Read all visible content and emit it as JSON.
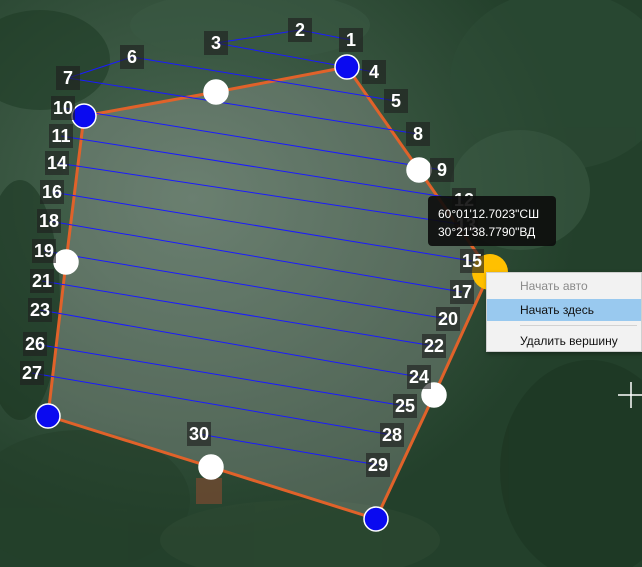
{
  "map": {
    "boundary_color": "#e0622a",
    "track_color": "#1a1aff",
    "vertex_active_color": "#0a0af0",
    "vertex_inactive_color": "#ffffff",
    "vertex_selected_color": "#ffc000",
    "vertex_icon": "circle-marker-icon",
    "cursor_icon": "crosshair-cursor-icon"
  },
  "waypoints": [
    "1",
    "2",
    "3",
    "4",
    "5",
    "6",
    "7",
    "8",
    "9",
    "10",
    "11",
    "12",
    "13",
    "14",
    "15",
    "16",
    "17",
    "18",
    "19",
    "20",
    "21",
    "22",
    "23",
    "24",
    "25",
    "26",
    "27",
    "28",
    "29",
    "30"
  ],
  "tooltip": {
    "latitude": "60°01'12.7023\"СШ",
    "longitude": "30°21'38.7790\"ВД"
  },
  "context_menu": {
    "items": [
      {
        "label": "Начать авто",
        "enabled": false
      },
      {
        "label": "Начать здесь",
        "enabled": true
      },
      {
        "label": "Удалить вершину",
        "enabled": true
      }
    ]
  }
}
